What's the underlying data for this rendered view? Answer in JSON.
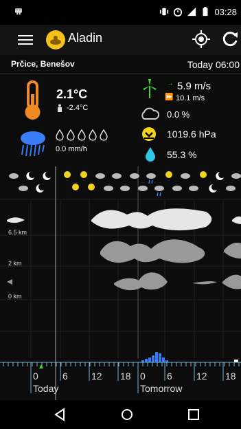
{
  "status": {
    "time": "03:28"
  },
  "app": {
    "title": "Aladin"
  },
  "location": {
    "name": "Prčice, Benešov",
    "when": "Today 06:00"
  },
  "current": {
    "temperature": "2.1°C",
    "feels_like": "-2.4°C",
    "rain": "0.0 mm/h",
    "wind": "5.9 m/s",
    "gust": "10.1 m/s",
    "cloud": "0.0 %",
    "pressure": "1019.6 hPa",
    "humidity": "55.3 %"
  },
  "chart": {
    "altitudes": [
      "6.5 km",
      "2 km",
      "0 km"
    ],
    "hour_ticks": [
      "0",
      "6",
      "12",
      "18",
      "0",
      "6",
      "12",
      "18"
    ],
    "day_labels": [
      "Today",
      "Tomorrow"
    ]
  },
  "colors": {
    "accent_orange": "#f08a24",
    "rain_blue": "#3a7ef7",
    "wind_green": "#3ed72c",
    "pressure_yellow": "#f3d21b",
    "humidity_teal": "#2ec6e0"
  }
}
